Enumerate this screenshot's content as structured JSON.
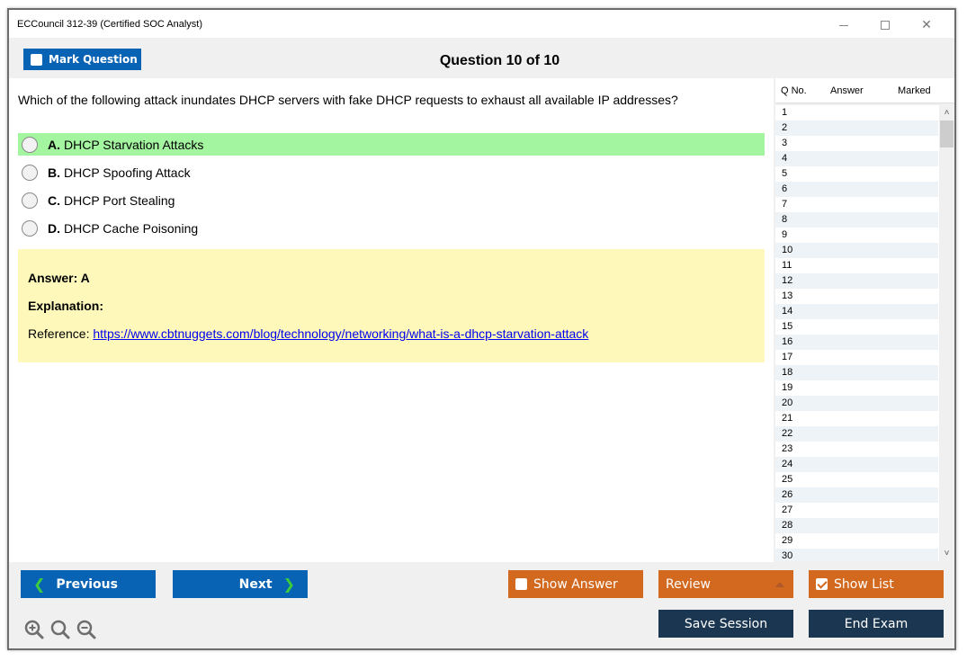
{
  "window": {
    "title": "ECCouncil 312-39 (Certified SOC Analyst)",
    "controls": {
      "minimize": "minimize-icon",
      "maximize": "maximize-icon",
      "close": "close-icon"
    }
  },
  "toolbar": {
    "mark_label": "Mark Question",
    "mark_checked": false,
    "heading": "Question 10 of 10"
  },
  "question": {
    "text": "Which of the following attack inundates DHCP servers with fake DHCP requests to exhaust all available IP addresses?",
    "options": [
      {
        "letter": "A.",
        "text": "DHCP Starvation Attacks",
        "correct": true
      },
      {
        "letter": "B.",
        "text": "DHCP Spoofing Attack",
        "correct": false
      },
      {
        "letter": "C.",
        "text": "DHCP Port Stealing",
        "correct": false
      },
      {
        "letter": "D.",
        "text": "DHCP Cache Poisoning",
        "correct": false
      }
    ]
  },
  "answer": {
    "answer_label": "Answer: A",
    "explanation_label": "Explanation:",
    "reference_prefix": "Reference: ",
    "reference_link": "https://www.cbtnuggets.com/blog/technology/networking/what-is-a-dhcp-starvation-attack"
  },
  "question_list": {
    "headers": [
      "Q No.",
      "Answer",
      "Marked"
    ],
    "rows": [
      "1",
      "2",
      "3",
      "4",
      "5",
      "6",
      "7",
      "8",
      "9",
      "10",
      "11",
      "12",
      "13",
      "14",
      "15",
      "16",
      "17",
      "18",
      "19",
      "20",
      "21",
      "22",
      "23",
      "24",
      "25",
      "26",
      "27",
      "28",
      "29",
      "30"
    ],
    "scroll_up": "˄",
    "scroll_down": "˅"
  },
  "buttons": {
    "previous": "Previous",
    "next": "Next",
    "show_answer": "Show Answer",
    "show_answer_checked": false,
    "review": "Review",
    "show_list": "Show List",
    "show_list_checked": true,
    "save_session": "Save Session",
    "end_exam": "End Exam"
  },
  "colors": {
    "primary_blue": "#0863b4",
    "orange": "#d2691e",
    "navy": "#1b3650",
    "correct_green": "#a4f5a0",
    "answer_yellow": "#fef8bb"
  }
}
